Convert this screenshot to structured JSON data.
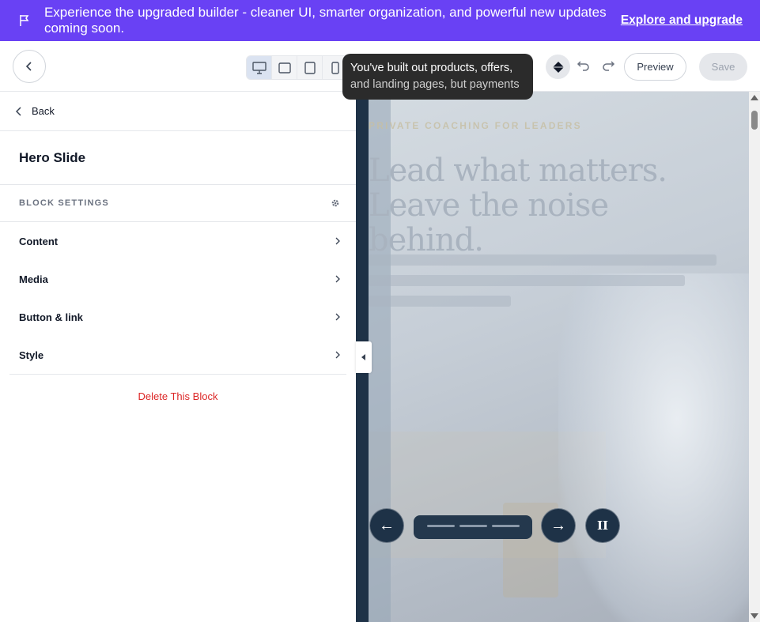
{
  "banner": {
    "message": "Experience the upgraded builder - cleaner UI, smarter organization, and powerful new updates coming soon.",
    "cta": "Explore and upgrade",
    "icon": "flag-icon",
    "color": "#6941f4"
  },
  "toolbar": {
    "devices": [
      "desktop",
      "tablet-landscape",
      "tablet-portrait",
      "mobile"
    ],
    "active_device": "desktop",
    "tooltip_line1": "You've built out products, offers,",
    "tooltip_line2": "and landing pages, but payments",
    "preview_label": "Preview",
    "save_label": "Save"
  },
  "sidebar": {
    "back_label": "Back",
    "block_title": "Hero Slide",
    "settings_heading": "BLOCK SETTINGS",
    "sections": [
      {
        "label": "Content"
      },
      {
        "label": "Media"
      },
      {
        "label": "Button & link"
      },
      {
        "label": "Style"
      }
    ],
    "delete_label": "Delete This Block"
  },
  "preview": {
    "eyebrow": "PRIVATE COACHING FOR LEADERS",
    "headline": "Lead what matters. Leave the noise behind.",
    "prev_arrow": "←",
    "next_arrow": "→",
    "pause_symbol": "II",
    "slides": 3
  },
  "colors": {
    "accent": "#6941f4",
    "danger": "#dc2626",
    "canvas_bg": "#1e3247"
  }
}
